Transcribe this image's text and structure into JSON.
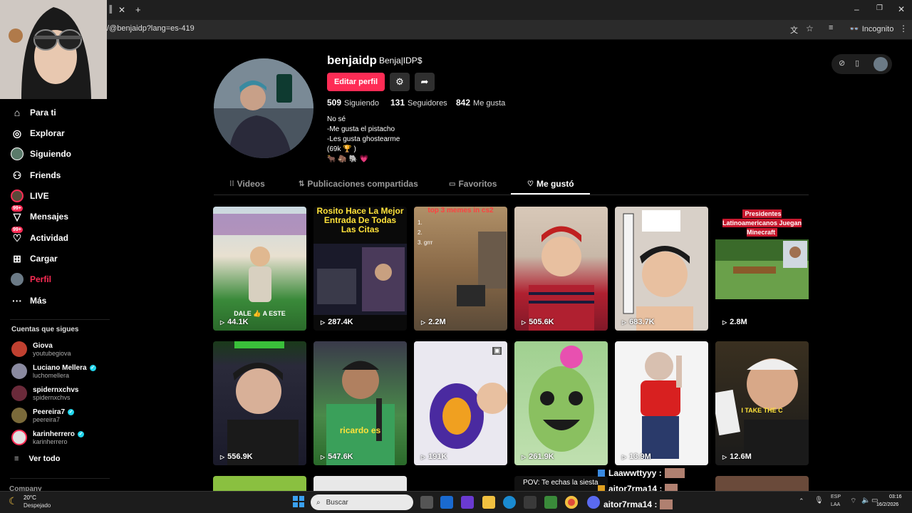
{
  "browser": {
    "url": "/@benjaidp?lang=es-419",
    "incognito_label": "Incognito",
    "tab_close": "✕",
    "new_tab": "+"
  },
  "sidebar": {
    "nav": [
      {
        "label": "Para ti",
        "icon": "home-icon"
      },
      {
        "label": "Explorar",
        "icon": "compass-icon"
      },
      {
        "label": "Siguiendo",
        "icon": "following-avatar-icon"
      },
      {
        "label": "Friends",
        "icon": "friends-icon"
      },
      {
        "label": "LIVE",
        "icon": "live-icon"
      },
      {
        "label": "Mensajes",
        "icon": "messages-icon",
        "badge": "99+"
      },
      {
        "label": "Actividad",
        "icon": "activity-icon",
        "badge": "99+"
      },
      {
        "label": "Cargar",
        "icon": "upload-icon"
      },
      {
        "label": "Perfil",
        "icon": "profile-avatar-icon"
      },
      {
        "label": "Más",
        "icon": "more-icon"
      }
    ],
    "following_title": "Cuentas que sigues",
    "following": [
      {
        "name": "Giova",
        "handle": "youtubegiova",
        "verified": false
      },
      {
        "name": "Luciano Mellera",
        "handle": "luchomellera",
        "verified": true
      },
      {
        "name": "spidernxchvs",
        "handle": "spidernxchvs",
        "verified": false
      },
      {
        "name": "Peereira7",
        "handle": "peereira7",
        "verified": true
      },
      {
        "name": "karinherrero",
        "handle": "karinherrero",
        "verified": true
      }
    ],
    "see_all": "Ver todo",
    "company": "Company"
  },
  "profile": {
    "username": "benjaidp",
    "nickname": "Benja|IDP$",
    "edit_label": "Editar perfil",
    "following_count": "509",
    "following_label": "Siguiendo",
    "followers_count": "131",
    "followers_label": "Seguidores",
    "likes_count": "842",
    "likes_label": "Me gusta",
    "bio_lines": [
      "No sé",
      "-Me gusta el pistacho",
      "-Les gusta ghostearme",
      "(69k 🏆 )",
      "🐂 🦣 🐘 💗"
    ]
  },
  "tabs": [
    {
      "label": "Videos",
      "icon": "grid-icon"
    },
    {
      "label": "Publicaciones compartidas",
      "icon": "repost-icon"
    },
    {
      "label": "Favoritos",
      "icon": "bookmark-icon"
    },
    {
      "label": "Me gustó",
      "icon": "heart-icon",
      "active": true
    }
  ],
  "videos": [
    {
      "views": "44.1K",
      "caption": "DALE 👍 A ESTE",
      "bg": "#4a8a3a"
    },
    {
      "views": "287.4K",
      "caption": "Rosito Hace La Mejor Entrada De Todas Las Citas",
      "bg": "#111"
    },
    {
      "views": "2.2M",
      "caption": "top 3 memes in cs2",
      "bg": "#8a7050"
    },
    {
      "views": "505.6K",
      "caption": "",
      "bg": "#b02030"
    },
    {
      "views": "683.7K",
      "caption": "",
      "bg": "#d8d0c8"
    },
    {
      "views": "2.8M",
      "caption": "Presidentes Latinoamericanos Juegan Minecraft",
      "bg": "#000"
    },
    {
      "views": "556.9K",
      "caption": "",
      "bg": "#2a2a3a"
    },
    {
      "views": "547.6K",
      "caption": "ricardo es",
      "bg": "#3a6a3a"
    },
    {
      "views": "191K",
      "caption": "",
      "bg": "#e8e8f0"
    },
    {
      "views": "261.9K",
      "caption": "",
      "bg": "#9fd08a"
    },
    {
      "views": "13.9M",
      "caption": "",
      "bg": "#f0f0f0"
    },
    {
      "views": "12.6M",
      "caption": "I TAKE THE C",
      "bg": "#1a1a1a"
    }
  ],
  "overlay_chat": [
    {
      "user": "Laawwttyyy :"
    },
    {
      "user": "aitor7rma14 :"
    },
    {
      "user": "aitor7rma14 :"
    }
  ],
  "partial_caption": "POV: Te echas la siesta",
  "taskbar": {
    "weather_temp": "20°C",
    "weather_desc": "Despejado",
    "search_placeholder": "Buscar",
    "lang1": "ESP",
    "lang2": "LAA",
    "time": "03:16",
    "date": "16/2/2026"
  }
}
